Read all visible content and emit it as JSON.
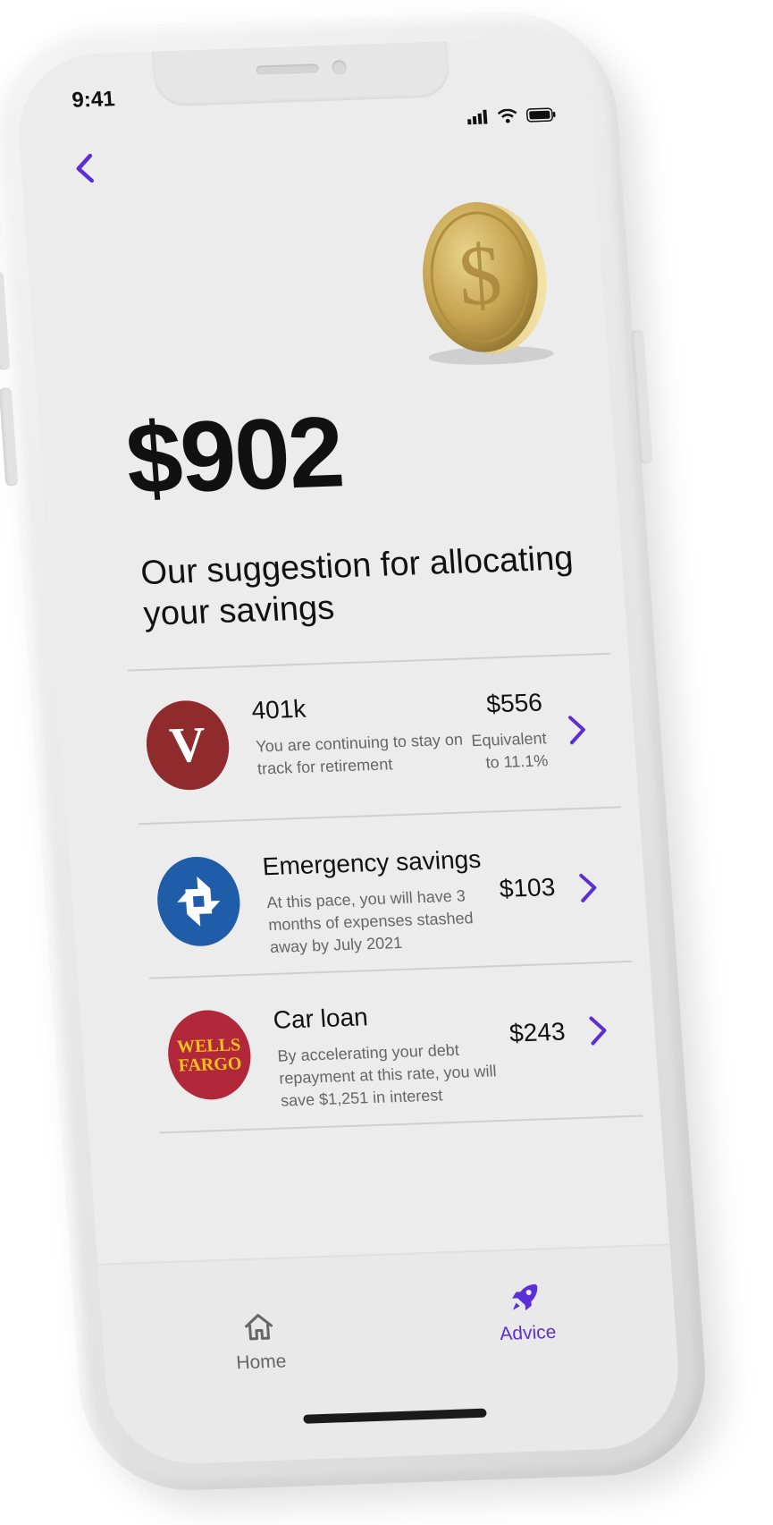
{
  "status_bar": {
    "time": "9:41"
  },
  "header": {
    "back_icon": "chevron-left-icon",
    "hero_icon": "dollar-coin-icon"
  },
  "summary": {
    "amount": "$902",
    "subtitle": "Our suggestion for allocating your savings"
  },
  "allocations": [
    {
      "logo": "V",
      "logo_color": "#8f2a2d",
      "title": "401k",
      "description": "You are continuing to stay on track for retirement",
      "amount": "$556",
      "note": "Equivalent to 11.1%"
    },
    {
      "logo": "chase-octagon",
      "logo_color": "#1f5da8",
      "title": "Emergency savings",
      "description": "At this pace, you will have 3 months of expenses stashed away by July 2021",
      "amount": "$103",
      "note": ""
    },
    {
      "logo_lines": [
        "WELLS",
        "FARGO"
      ],
      "logo_color": "#b1283a",
      "logo_text_color": "#f4c21a",
      "title": "Car loan",
      "description": "By accelerating your debt repayment at this rate, you will save $1,251 in interest",
      "amount": "$243",
      "note": ""
    }
  ],
  "tabbar": {
    "items": [
      {
        "label": "Home",
        "icon": "home-icon",
        "active": false
      },
      {
        "label": "Advice",
        "icon": "rocket-icon",
        "active": true
      }
    ]
  },
  "colors": {
    "accent": "#5b2fd6",
    "text_primary": "#111111",
    "text_secondary": "#666666",
    "screen_bg": "#ececec"
  }
}
